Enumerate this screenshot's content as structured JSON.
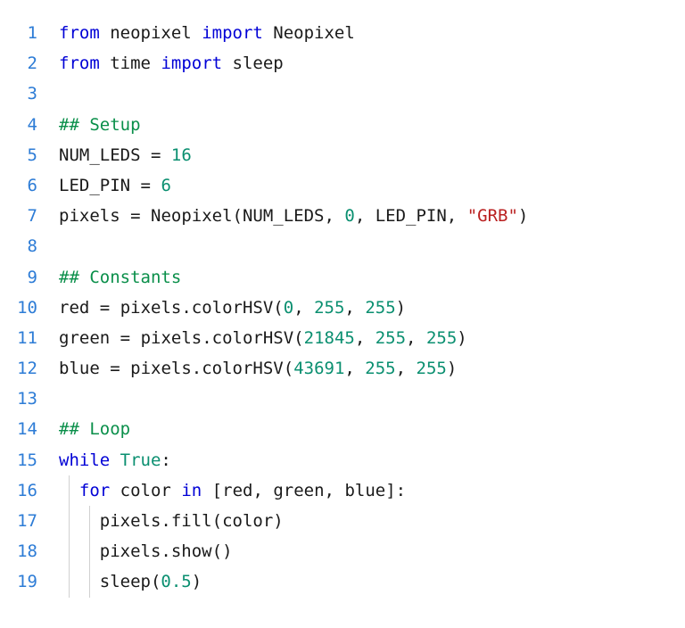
{
  "line_numbers": [
    "1",
    "2",
    "3",
    "4",
    "5",
    "6",
    "7",
    "8",
    "9",
    "10",
    "11",
    "12",
    "13",
    "14",
    "15",
    "16",
    "17",
    "18",
    "19"
  ],
  "tokens": {
    "l1": {
      "from": "from",
      "sp": " ",
      "neopixel": "neopixel",
      "sp2": " ",
      "import": "import",
      "sp3": " ",
      "Neopixel": "Neopixel"
    },
    "l2": {
      "from": "from",
      "sp": " ",
      "time": "time",
      "sp2": " ",
      "import": "import",
      "sp3": " ",
      "sleep": "sleep"
    },
    "l4": {
      "comment": "## Setup"
    },
    "l5": {
      "NUM_LEDS": "NUM_LEDS",
      "sp": " ",
      "eq": "=",
      "sp2": " ",
      "val": "16"
    },
    "l6": {
      "LED_PIN": "LED_PIN",
      "sp": " ",
      "eq": "=",
      "sp2": " ",
      "val": "6"
    },
    "l7": {
      "pixels": "pixels",
      "sp": " ",
      "eq": "=",
      "sp2": " ",
      "Neopixel": "Neopixel",
      "lp": "(",
      "NUM_LEDS": "NUM_LEDS",
      "c1": ", ",
      "z": "0",
      "c2": ", ",
      "LED_PIN": "LED_PIN",
      "c3": ", ",
      "grb": "\"GRB\"",
      "rp": ")"
    },
    "l9": {
      "comment": "## Constants"
    },
    "l10": {
      "red": "red",
      "sp": " ",
      "eq": "=",
      "sp2": " ",
      "pixels": "pixels",
      "dot": ".",
      "colorHSV": "colorHSV",
      "lp": "(",
      "a": "0",
      "c1": ", ",
      "b": "255",
      "c2": ", ",
      "c": "255",
      "rp": ")"
    },
    "l11": {
      "green": "green",
      "sp": " ",
      "eq": "=",
      "sp2": " ",
      "pixels": "pixels",
      "dot": ".",
      "colorHSV": "colorHSV",
      "lp": "(",
      "a": "21845",
      "c1": ", ",
      "b": "255",
      "c2": ", ",
      "c": "255",
      "rp": ")"
    },
    "l12": {
      "blue": "blue",
      "sp": " ",
      "eq": "=",
      "sp2": " ",
      "pixels": "pixels",
      "dot": ".",
      "colorHSV": "colorHSV",
      "lp": "(",
      "a": "43691",
      "c1": ", ",
      "b": "255",
      "c2": ", ",
      "c": "255",
      "rp": ")"
    },
    "l14": {
      "comment": "## Loop"
    },
    "l15": {
      "while": "while",
      "sp": " ",
      "True": "True",
      "colon": ":"
    },
    "l16": {
      "for": "for",
      "sp": " ",
      "color": "color",
      "sp2": " ",
      "in": "in",
      "sp3": " ",
      "lb": "[",
      "red": "red",
      "c1": ", ",
      "green": "green",
      "c2": ", ",
      "blue": "blue",
      "rb": "]",
      "colon": ":"
    },
    "l17": {
      "pixels": "pixels",
      "dot": ".",
      "fill": "fill",
      "lp": "(",
      "color": "color",
      "rp": ")"
    },
    "l18": {
      "pixels": "pixels",
      "dot": ".",
      "show": "show",
      "lp": "(",
      "rp": ")"
    },
    "l19": {
      "sleep": "sleep",
      "lp": "(",
      "val": "0.5",
      "rp": ")"
    }
  }
}
